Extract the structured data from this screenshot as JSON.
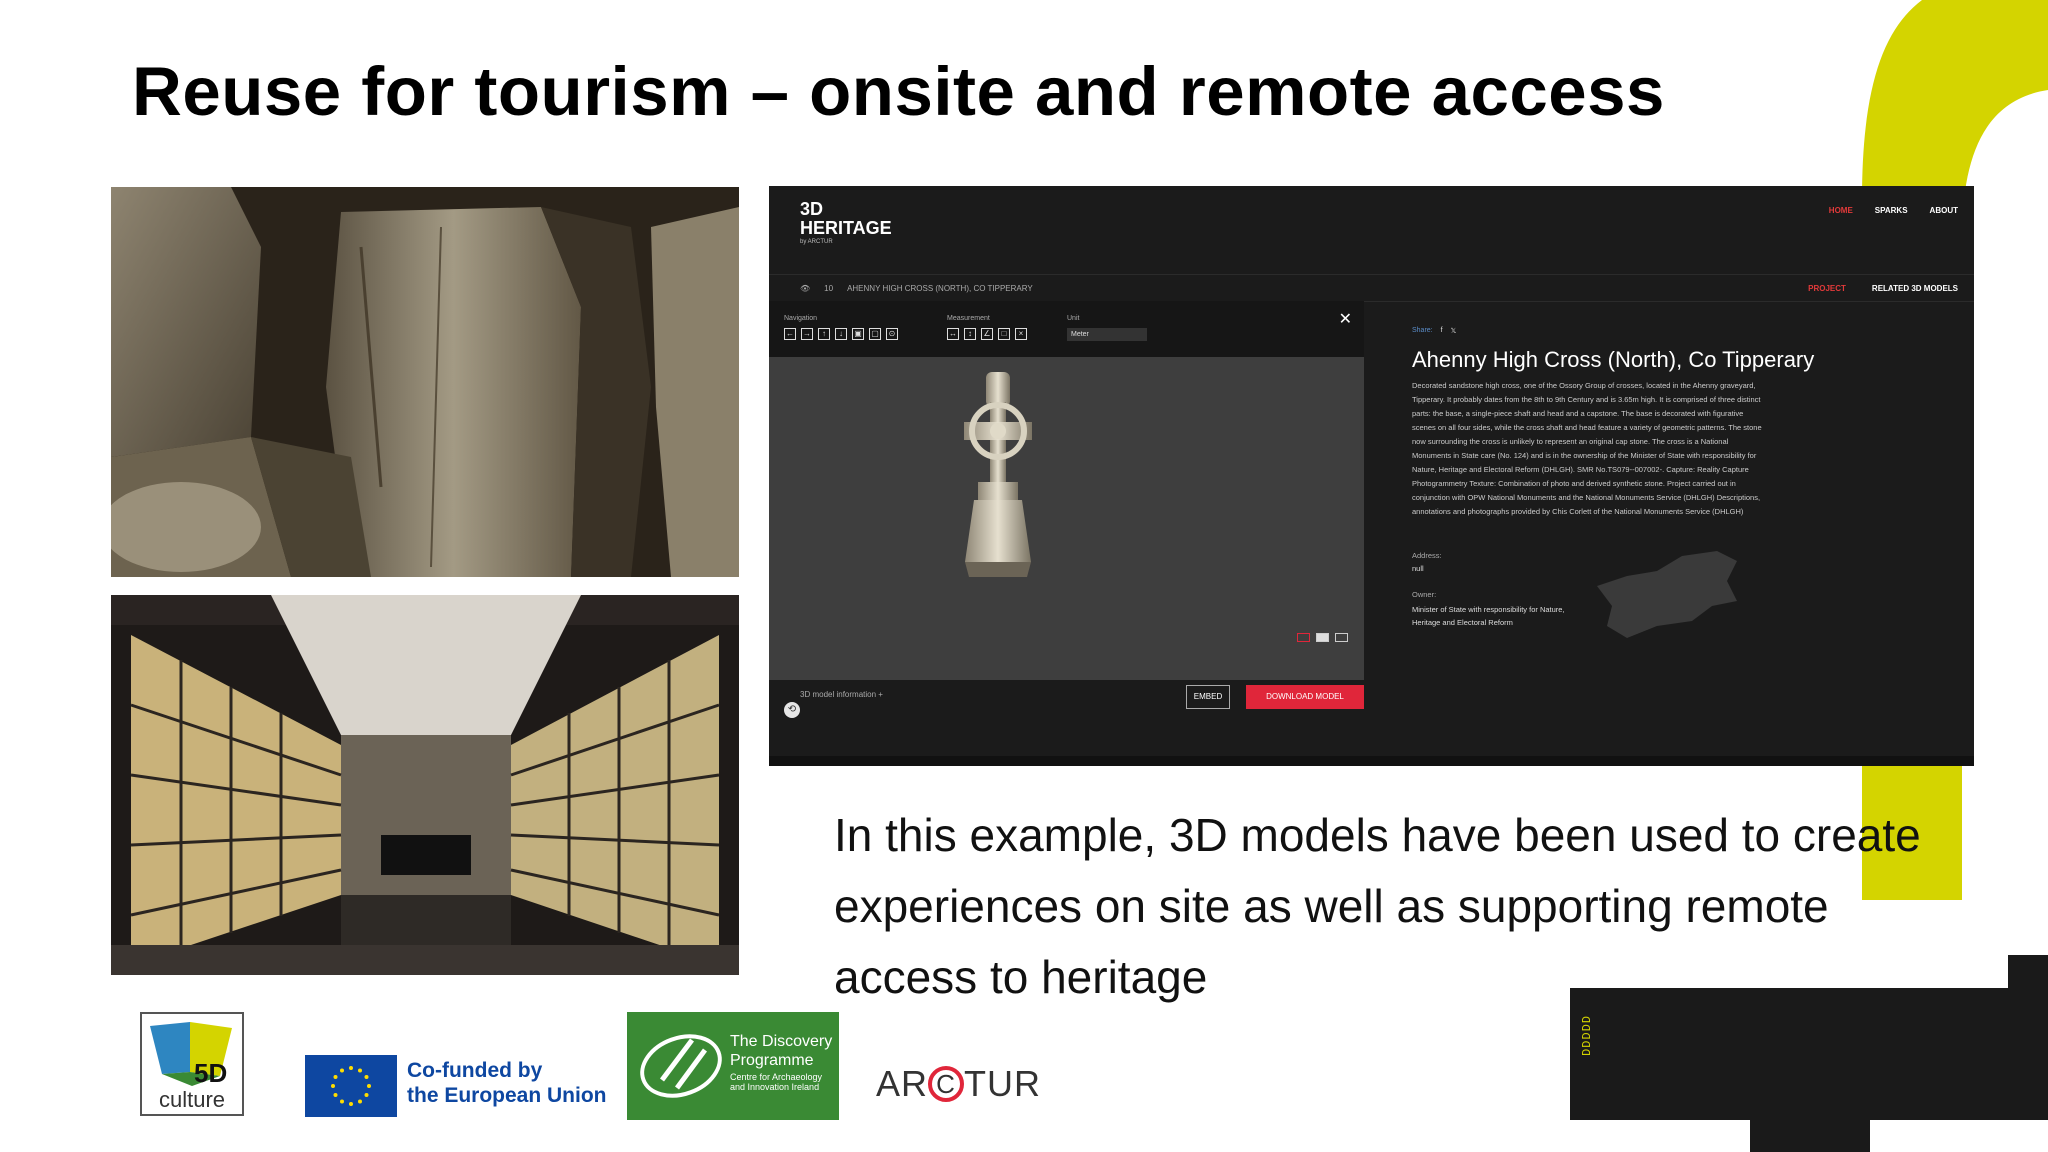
{
  "slide": {
    "title": "Reuse for tourism – onsite and remote access",
    "body": "In this example, 3D models have been used to create experiences on site as well as supporting remote access to heritage",
    "side_mark": "DDDDD"
  },
  "site": {
    "logo_line1": "3D",
    "logo_line2": "HERITAGE",
    "logo_by": "by ARCTUR",
    "nav": [
      "HOME",
      "SPARKS",
      "ABOUT"
    ],
    "views": "10",
    "breadcrumb": "AHENNY HIGH CROSS (NORTH), CO TIPPERARY",
    "subnav": [
      "PROJECT",
      "RELATED 3D MODELS"
    ]
  },
  "viewer": {
    "navigation_label": "Navigation",
    "measurement_label": "Measurement",
    "unit_label": "Unit",
    "unit_value": "Meter",
    "close": "✕",
    "model_info": "3D model information",
    "embed_label": "EMBED",
    "download_label": "DOWNLOAD MODEL"
  },
  "info": {
    "share_label": "Share:",
    "title": "Ahenny High Cross (North), Co Tipperary",
    "description": "Decorated sandstone high cross, one of the Ossory Group of crosses, located in the Ahenny graveyard, Tipperary. It probably dates from the 8th to 9th Century and is 3.65m high. It is comprised of three distinct parts: the base, a single-piece shaft and head and a capstone. The base is decorated with figurative scenes on all four sides, while the cross shaft and head feature a variety of geometric patterns. The stone now surrounding the cross is unlikely to represent an original cap stone. The cross is a National Monuments in State care (No. 124) and is in the ownership of the Minister of State with responsibility for Nature, Heritage and Electoral Reform (DHLGH). SMR No.TS079--007002-. Capture: Reality Capture Photogrammetry Texture: Combination of photo and derived synthetic stone. Project carried out in conjunction with OPW National Monuments and the National Monuments Service (DHLGH) Descriptions, annotations and photographs provided by Chis Corlett of the National Monuments Service (DHLGH)",
    "address_label": "Address:",
    "address_value": "null",
    "owner_label": "Owner:",
    "owner_value": "Minister of State with responsibility for Nature, Heritage and Electoral Reform"
  },
  "logos": {
    "fived_top": "5D",
    "fived_bottom": "culture",
    "eu_line1": "Co-funded by",
    "eu_line2": "the European Union",
    "dp_line1": "The Discovery",
    "dp_line2": "Programme",
    "dp_sub1": "Centre for Archaeology",
    "dp_sub2": "and Innovation Ireland",
    "arctur_a": "AR",
    "arctur_c": "C",
    "arctur_b": "TUR"
  },
  "colors": {
    "accent_yellow": "#d4d400",
    "accent_red": "#e0263a",
    "eu_blue": "#0e47a1",
    "dp_green": "#3a8a34"
  }
}
